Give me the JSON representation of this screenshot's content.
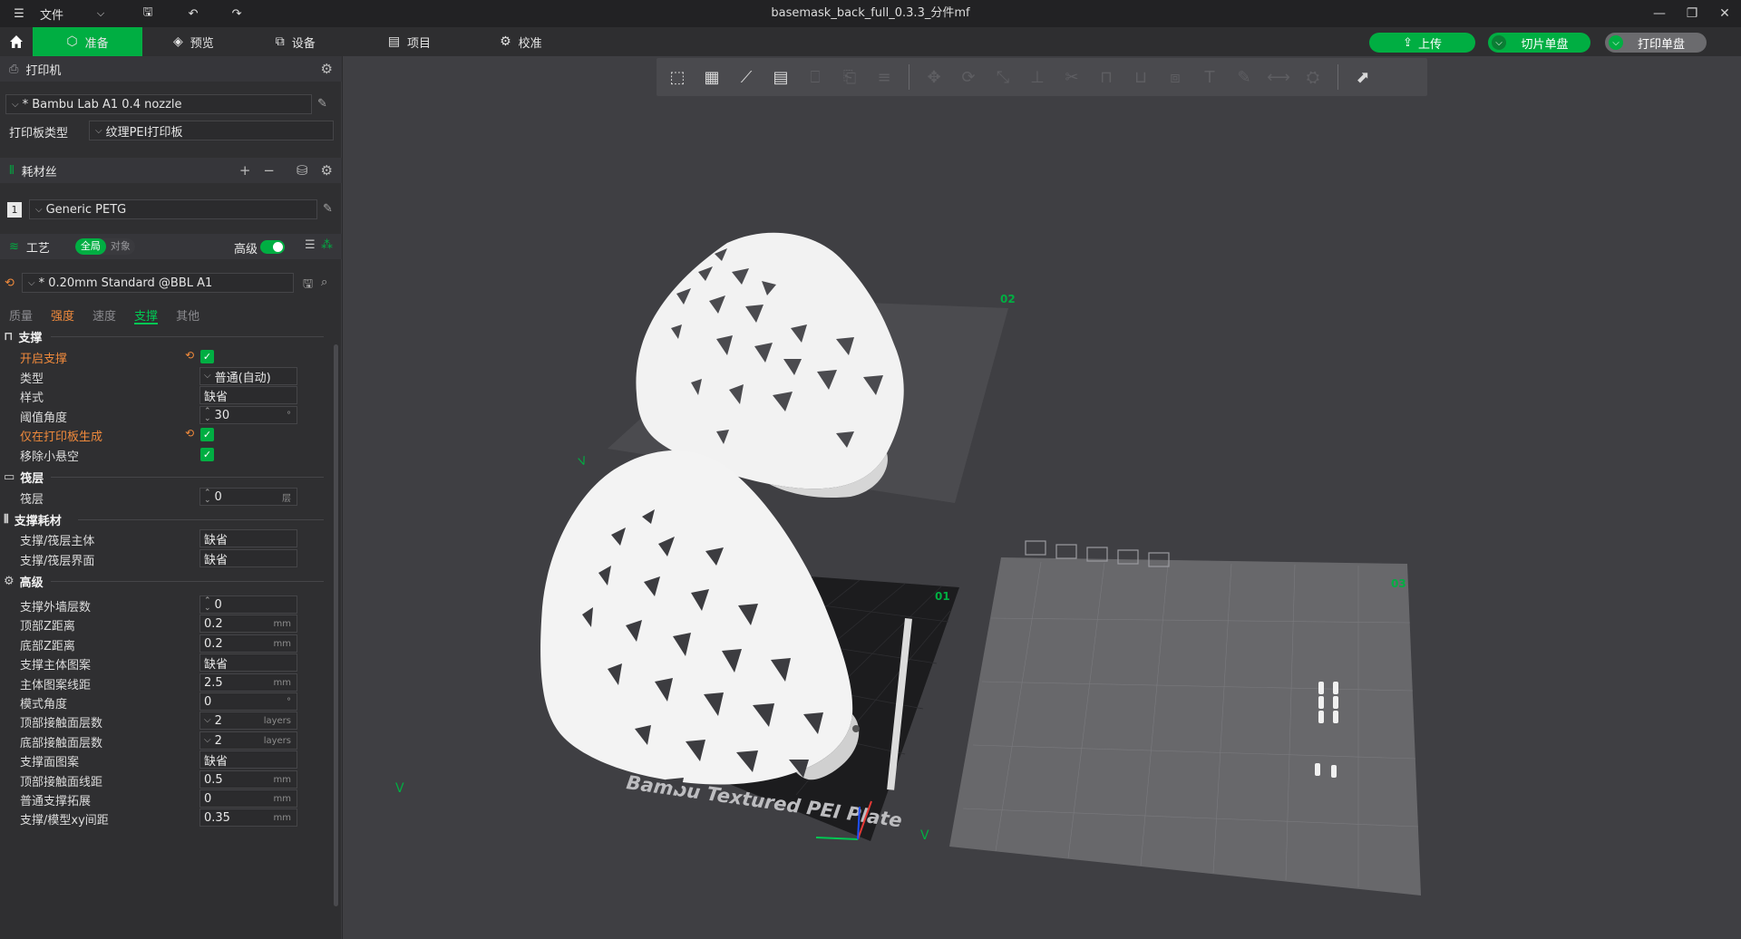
{
  "titlebar": {
    "menu_label": "文件",
    "title": "basemask_back_full_0.3.3_分件mf"
  },
  "nav": {
    "tabs": [
      {
        "label": "准备",
        "active": true
      },
      {
        "label": "预览"
      },
      {
        "label": "设备"
      },
      {
        "label": "项目"
      },
      {
        "label": "校准"
      }
    ],
    "upload_label": "上传",
    "slice_label": "切片单盘",
    "print_label": "打印单盘"
  },
  "printer": {
    "section_label": "打印机",
    "preset": "* Bambu Lab A1 0.4 nozzle",
    "plate_type_label": "打印板类型",
    "plate_type": "纹理PEI打印板"
  },
  "filament": {
    "section_label": "耗材丝",
    "slot": "1",
    "preset": "Generic PETG"
  },
  "process": {
    "section_label": "工艺",
    "global_label": "全局",
    "object_label": "对象",
    "advanced_label": "高级",
    "preset": "* 0.20mm Standard @BBL A1",
    "subtabs": [
      "质量",
      "强度",
      "速度",
      "支撑",
      "其他"
    ]
  },
  "settings": {
    "support_group": "支撑",
    "enable_support": "开启支撑",
    "type_label": "类型",
    "type_value": "普通(自动)",
    "style_label": "样式",
    "style_value": "缺省",
    "threshold_label": "阈值角度",
    "threshold_value": "30",
    "threshold_unit": "°",
    "on_plate_only": "仅在打印板生成",
    "remove_small": "移除小悬空",
    "raft_group": "筏层",
    "raft_label": "筏层",
    "raft_value": "0",
    "raft_unit": "层",
    "filament_group": "支撑耗材",
    "base_label": "支撑/筏层主体",
    "base_value": "缺省",
    "interface_label": "支撑/筏层界面",
    "interface_value": "缺省",
    "advanced_group": "高级",
    "rows": [
      {
        "label": "支撑外墙层数",
        "value": "0",
        "unit": "",
        "spin": true
      },
      {
        "label": "顶部Z距离",
        "value": "0.2",
        "unit": "mm"
      },
      {
        "label": "底部Z距离",
        "value": "0.2",
        "unit": "mm"
      },
      {
        "label": "支撑主体图案",
        "value": "缺省",
        "unit": ""
      },
      {
        "label": "主体图案线距",
        "value": "2.5",
        "unit": "mm"
      },
      {
        "label": "模式角度",
        "value": "0",
        "unit": "°"
      },
      {
        "label": "顶部接触面层数",
        "value": "2",
        "unit": "layers",
        "chev": true
      },
      {
        "label": "底部接触面层数",
        "value": "2",
        "unit": "layers",
        "chev": true
      },
      {
        "label": "支撑面图案",
        "value": "缺省",
        "unit": ""
      },
      {
        "label": "顶部接触面线距",
        "value": "0.5",
        "unit": "mm"
      },
      {
        "label": "普通支撑拓展",
        "value": "0",
        "unit": "mm"
      },
      {
        "label": "支撑/模型xy间距",
        "value": "0.35",
        "unit": "mm"
      }
    ]
  },
  "plates": {
    "plate1_label": "Bambu Textured PEI Plate",
    "plate1_number": "01",
    "plate2_number": "02",
    "plate3_number": "03"
  }
}
